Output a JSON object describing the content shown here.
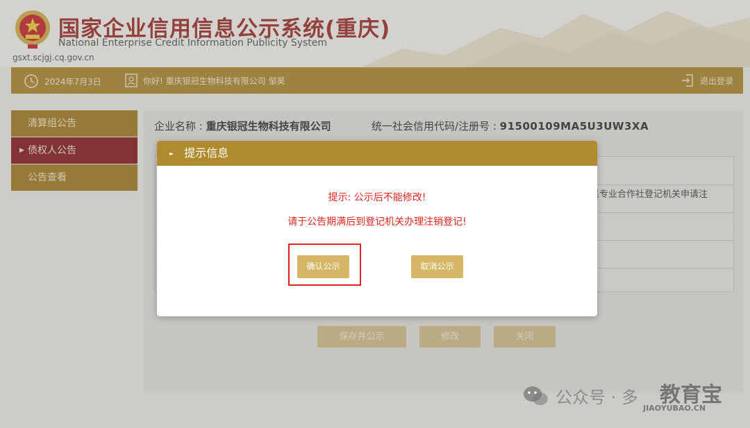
{
  "header": {
    "title": "国家企业信用信息公示系统(重庆)",
    "subtitle": "National Enterprise Credit Information Publicity System",
    "domain": "gsxt.scjgj.cq.gov.cn"
  },
  "topbar": {
    "date": "2024年7月3日",
    "greeting": "你好! 重庆银冠生物科技有限公司  邹昊",
    "logout": "退出登录"
  },
  "sidebar": {
    "items": [
      {
        "label": "清算组公告"
      },
      {
        "label": "债权人公告"
      },
      {
        "label": "公告查看"
      }
    ]
  },
  "main": {
    "company_label": "企业名称 : ",
    "company_name": "重庆银冠生物科技有限公司",
    "code_label": "统一社会信用代码/注册号 :  ",
    "code_value": "91500109MA5U3UW3XA",
    "bg_text": "农民专业合作社登记机关申请注",
    "buttons": {
      "save_publish": "保存并公示",
      "edit": "修改",
      "close": "关闭"
    }
  },
  "modal": {
    "title": "提示信息",
    "line1": "提示: 公示后不能修改!",
    "line2": "请于公告期满后到登记机关办理注销登记!",
    "confirm": "确认公示",
    "cancel": "取消公示"
  },
  "watermark": {
    "text": "公众号 · 多",
    "brand": "教育宝",
    "url": "JIAOYUBAO.CN"
  },
  "colors": {
    "gold": "#b08a2f",
    "active_red": "#8a1c1f",
    "alert_red": "#e0241d",
    "button_gold": "#d5b664"
  }
}
